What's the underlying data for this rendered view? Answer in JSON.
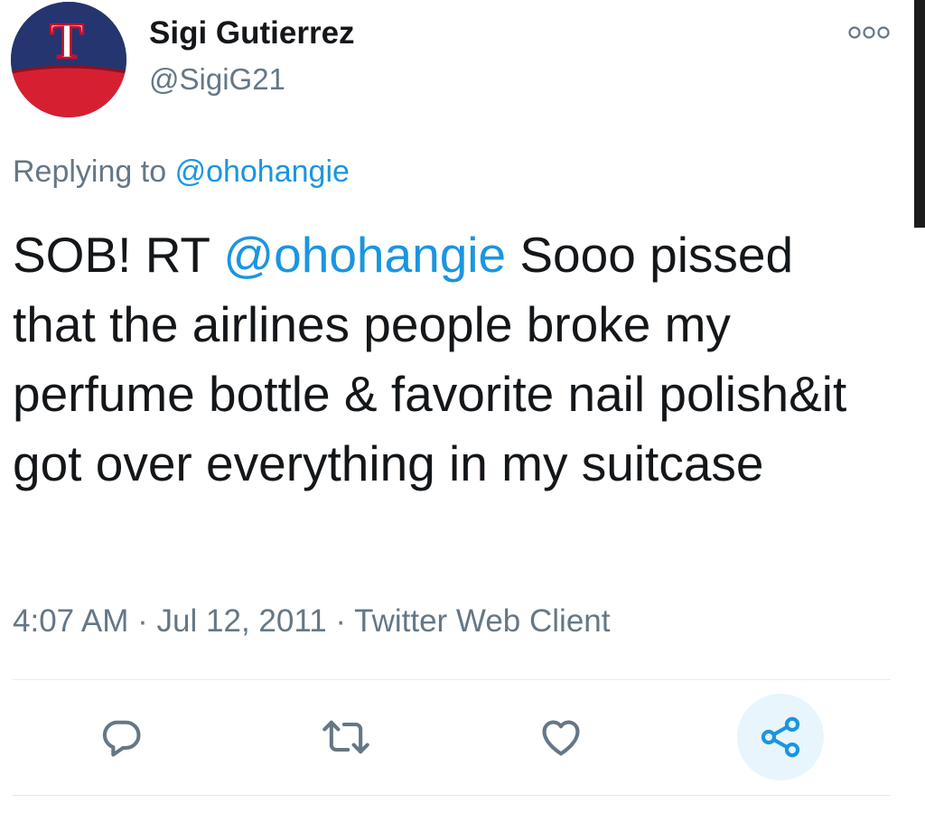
{
  "tweet": {
    "author": {
      "display_name": "Sigi Gutierrez",
      "handle": "@SigiG21",
      "avatar": "rangers-cap-avatar",
      "avatar_logo_text": "T"
    },
    "reply": {
      "prefix": "Replying to",
      "mention": "@ohohangie"
    },
    "text": {
      "prefix": "SOB! RT",
      "mention": "@ohohangie",
      "body": "Sooo pissed that the airlines people broke my perfume bottle & favorite nail polish&it got over everything in my suitcase"
    },
    "meta": {
      "time": "4:07 AM",
      "separator": "·",
      "date": "Jul 12, 2011",
      "source": "Twitter Web Client"
    }
  },
  "actions": [
    {
      "name": "reply",
      "icon": "reply-icon"
    },
    {
      "name": "retweet",
      "icon": "retweet-icon"
    },
    {
      "name": "like",
      "icon": "heart-icon"
    },
    {
      "name": "share",
      "icon": "share-icon"
    }
  ],
  "colors": {
    "text": "#14171a",
    "secondary": "#657786",
    "link": "#1b95e0",
    "share_highlight": "#e8f5fd",
    "divider": "#e6ecf0"
  }
}
